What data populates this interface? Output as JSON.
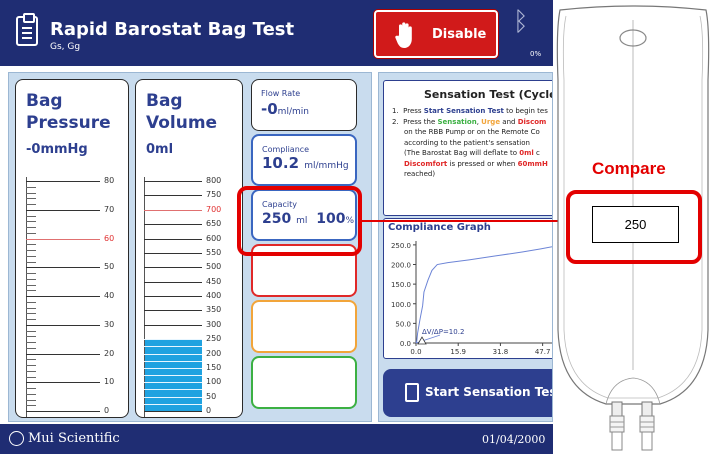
{
  "header": {
    "title": "Rapid Barostat Bag Test",
    "subtitle": "Gs, Gg",
    "disable_label": "Disable",
    "battery_pct": "0%"
  },
  "pressure_card": {
    "title_line1": "Bag",
    "title_line2": "Pressure",
    "value": "-0mmHg",
    "ticks": [
      "80",
      "70",
      "60",
      "50",
      "40",
      "30",
      "20",
      "10",
      "0"
    ],
    "red_tick": "60"
  },
  "volume_card": {
    "title_line1": "Bag",
    "title_line2": "Volume",
    "value": "0ml",
    "ticks": [
      "800",
      "750",
      "700",
      "650",
      "600",
      "550",
      "500",
      "450",
      "400",
      "350",
      "300",
      "250",
      "200",
      "150",
      "100",
      "50",
      "0"
    ],
    "red_tick": "700",
    "fill_level_ml": 250
  },
  "flow_rate": {
    "label": "Flow Rate",
    "value": "-0",
    "unit": "ml/min"
  },
  "compliance": {
    "label": "Compliance",
    "value": "10.2",
    "unit": "ml/mmHg"
  },
  "capacity": {
    "label": "Capacity",
    "value": "250",
    "unit": "ml",
    "percent": "100",
    "percent_unit": "%"
  },
  "sensation": {
    "title": "Sensation Test (Cycle",
    "step1_num": "1.",
    "step1_pre": "Press ",
    "step1_bold": "Start Sensation Test",
    "step1_post": " to begin tes",
    "step2_num": "2.",
    "step2_pre": "Press the ",
    "step2_a": "Sensation",
    "step2_comma": ", ",
    "step2_b": "Urge",
    "step2_and": " and ",
    "step2_c": "Discom",
    "line3": "on the RBB Pump or on the Remote Co",
    "line4": "according to the patient's sensation",
    "line5_pre": "(The Barostat Bag will deflate to ",
    "line5_bold": "0ml",
    "line5_post": " c",
    "line6_red": "Discomfort",
    "line6_mid": " is pressed or when ",
    "line6_bold": "60mmH",
    "line7": "reached)"
  },
  "graph": {
    "title": "Compliance Graph",
    "annotation": "ΔV/ΔP=10.2"
  },
  "start_button": {
    "label": "Start Sensation Test"
  },
  "footer": {
    "brand": "Mui Scientific",
    "date": "01/04/2000"
  },
  "compare": {
    "label": "Compare",
    "value": "250"
  },
  "chart_data": {
    "type": "line",
    "title": "Compliance Graph",
    "xlabel": "",
    "ylabel": "",
    "x_ticks": [
      "0.0",
      "15.9",
      "31.8",
      "47.7"
    ],
    "y_ticks": [
      "250.0",
      "200.0",
      "150.0",
      "100.0",
      "50.0",
      "0.0"
    ],
    "xlim": [
      0,
      55
    ],
    "ylim": [
      0,
      260
    ],
    "series": [
      {
        "x": [
          0,
          0.3,
          0.6,
          1.5,
          2.5,
          3.0,
          4.5,
          6.0,
          8.0,
          12,
          20,
          30,
          40,
          47,
          55
        ],
        "y": [
          0,
          5,
          25,
          60,
          95,
          130,
          160,
          185,
          200,
          205,
          212,
          222,
          232,
          240,
          250
        ]
      }
    ],
    "color": "#6c84d6",
    "annotation": "ΔV/ΔP=10.2"
  },
  "colors": {
    "header": "#1f2d73",
    "accent": "#2d3f8f",
    "panel": "#c9dcee",
    "disable": "#d11a1a",
    "fill": "#1fa2e0",
    "highlight": "#e30000"
  }
}
